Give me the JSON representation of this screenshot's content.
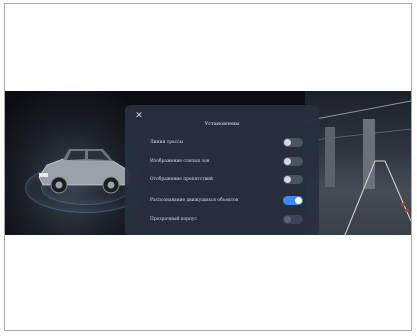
{
  "settings": {
    "close_icon": "close-icon",
    "title": "Установлены",
    "options": [
      {
        "label": "Линии трассы",
        "enabled": false,
        "disabled": false
      },
      {
        "label": "Изображение слепых зон",
        "enabled": false,
        "disabled": false
      },
      {
        "label": "Отображение препятствий",
        "enabled": false,
        "disabled": false
      },
      {
        "label": "Распознавание движущихся объектов",
        "enabled": true,
        "disabled": false
      },
      {
        "label": "Прозрачный корпус",
        "enabled": false,
        "disabled": true
      }
    ]
  },
  "colors": {
    "panel_bg": "#283040",
    "toggle_on": "#3b8cf0",
    "toggle_off": "#4a5266"
  }
}
